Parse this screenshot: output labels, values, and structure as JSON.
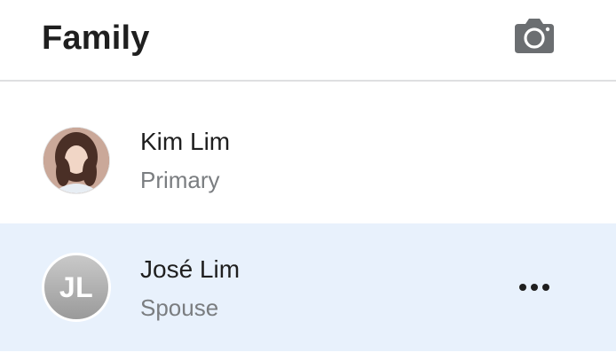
{
  "header": {
    "title": "Family",
    "camera_icon": "camera-icon"
  },
  "members": [
    {
      "name": "Kim Lim",
      "role": "Primary",
      "avatar_type": "photo"
    },
    {
      "name": "José Lim",
      "role": "Spouse",
      "avatar_type": "initials",
      "initials": "JL",
      "more_icon": "more-horizontal-icon"
    }
  ],
  "colors": {
    "selected_row_bg": "#e8f1fc",
    "title_text": "#1f1f1f",
    "secondary_text": "#7a7d80",
    "icon_gray": "#6b6e71"
  }
}
